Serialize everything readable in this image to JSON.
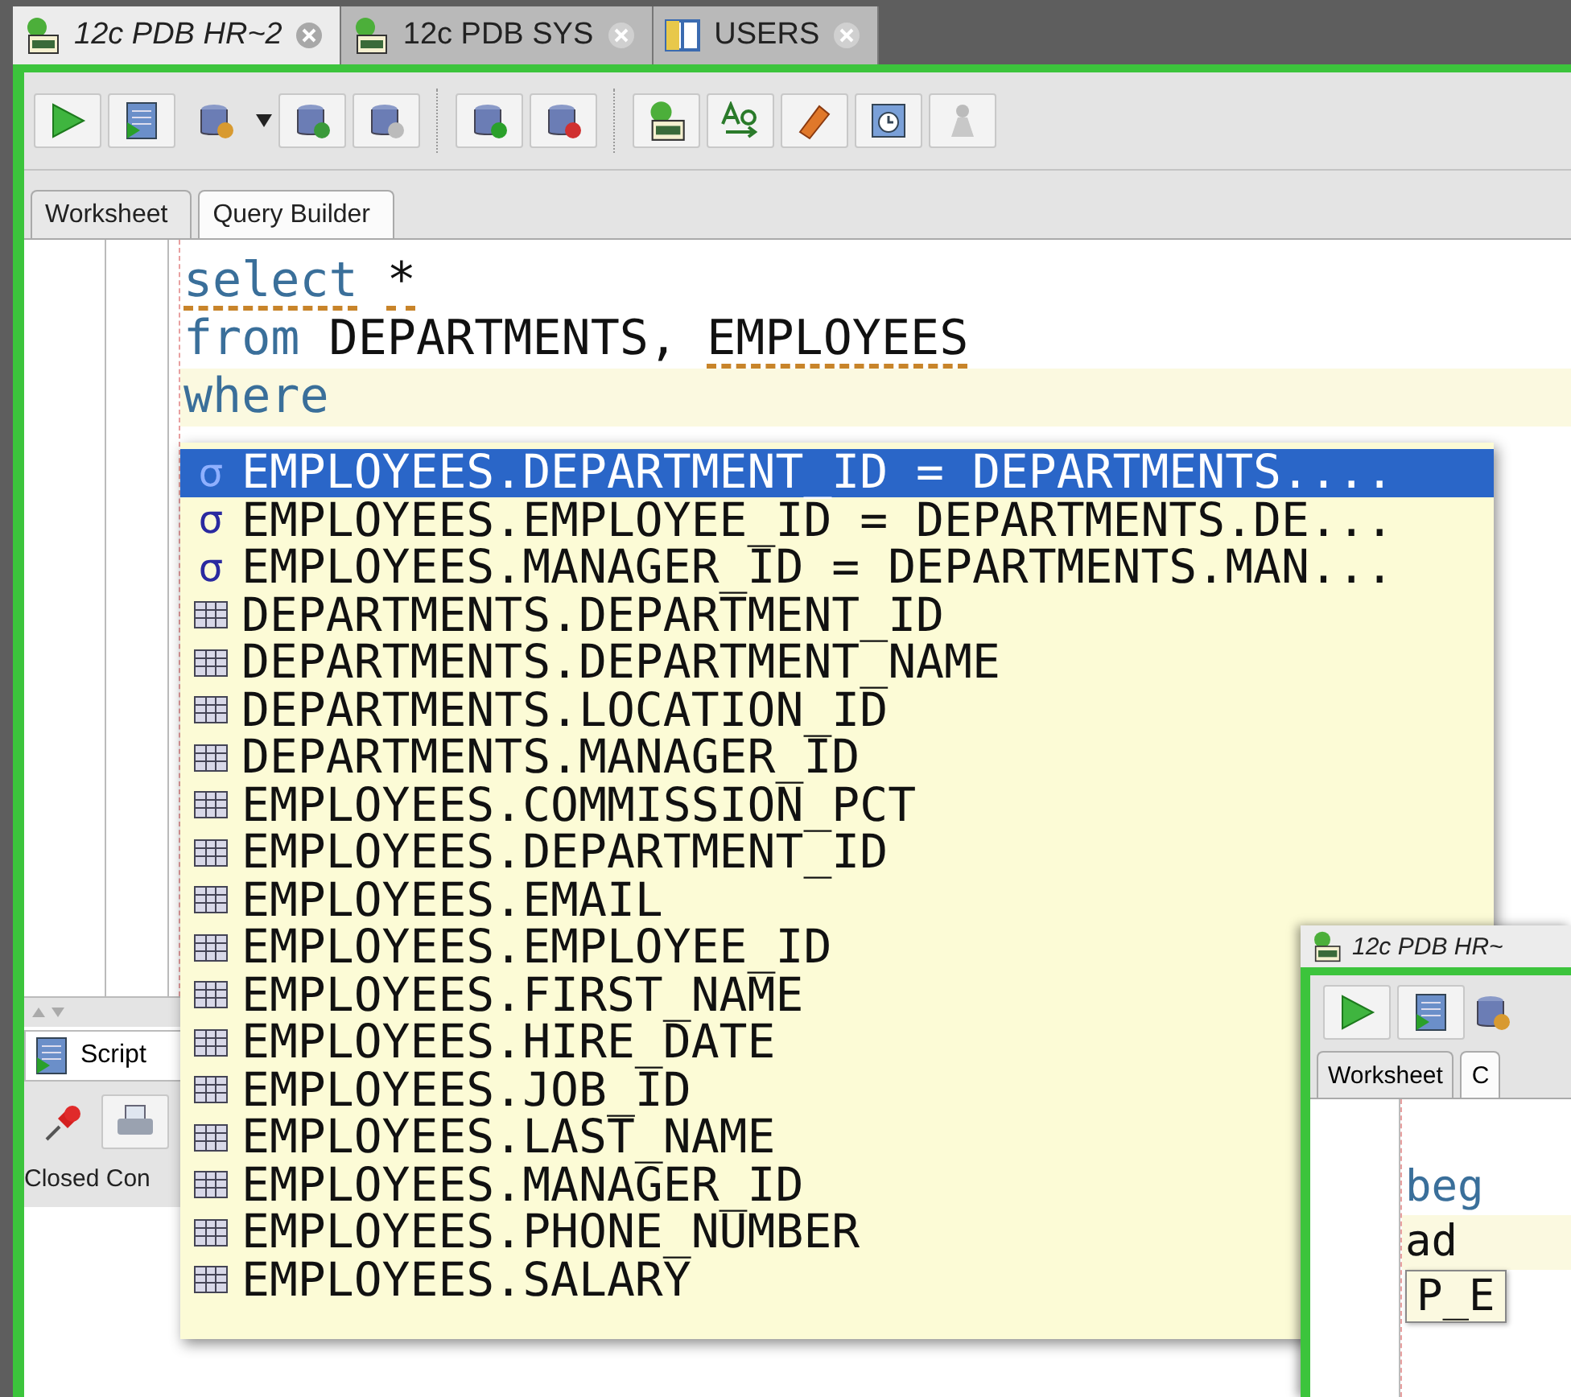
{
  "document_tabs": [
    {
      "label": "12c PDB HR~2",
      "kind": "sql",
      "modified": true,
      "selected": true
    },
    {
      "label": "12c PDB SYS",
      "kind": "sql",
      "modified": false,
      "selected": false
    },
    {
      "label": "USERS",
      "kind": "table",
      "modified": false,
      "selected": false
    }
  ],
  "editor_tabs": [
    {
      "label": "Worksheet",
      "selected": true
    },
    {
      "label": "Query Builder",
      "selected": false
    }
  ],
  "code_lines": [
    {
      "current": false,
      "tokens": [
        {
          "text": "select",
          "kind": "keyword",
          "flagged": true
        },
        {
          "text": "*",
          "kind": "plain",
          "flagged": true
        }
      ]
    },
    {
      "current": false,
      "tokens": [
        {
          "text": "from",
          "kind": "keyword",
          "flagged": false
        },
        {
          "text": "DEPARTMENTS,",
          "kind": "plain",
          "flagged": false
        },
        {
          "text": "EMPLOYEES",
          "kind": "plain",
          "flagged": true
        }
      ]
    },
    {
      "current": true,
      "tokens": [
        {
          "text": "where",
          "kind": "keyword",
          "flagged": false
        }
      ]
    }
  ],
  "completion_popup": {
    "items": [
      {
        "kind": "join",
        "symbol": "σ",
        "text": "EMPLOYEES.DEPARTMENT_ID = DEPARTMENTS....",
        "selected": true
      },
      {
        "kind": "join",
        "symbol": "σ",
        "text": "EMPLOYEES.EMPLOYEE_ID = DEPARTMENTS.DE...",
        "selected": false
      },
      {
        "kind": "join",
        "symbol": "σ",
        "text": "EMPLOYEES.MANAGER_ID = DEPARTMENTS.MAN...",
        "selected": false
      },
      {
        "kind": "column",
        "text": "DEPARTMENTS.DEPARTMENT_ID",
        "selected": false
      },
      {
        "kind": "column",
        "text": "DEPARTMENTS.DEPARTMENT_NAME",
        "selected": false
      },
      {
        "kind": "column",
        "text": "DEPARTMENTS.LOCATION_ID",
        "selected": false
      },
      {
        "kind": "column",
        "text": "DEPARTMENTS.MANAGER_ID",
        "selected": false
      },
      {
        "kind": "column",
        "text": "EMPLOYEES.COMMISSION_PCT",
        "selected": false
      },
      {
        "kind": "column",
        "text": "EMPLOYEES.DEPARTMENT_ID",
        "selected": false
      },
      {
        "kind": "column",
        "text": "EMPLOYEES.EMAIL",
        "selected": false
      },
      {
        "kind": "column",
        "text": "EMPLOYEES.EMPLOYEE_ID",
        "selected": false
      },
      {
        "kind": "column",
        "text": "EMPLOYEES.FIRST_NAME",
        "selected": false
      },
      {
        "kind": "column",
        "text": "EMPLOYEES.HIRE_DATE",
        "selected": false
      },
      {
        "kind": "column",
        "text": "EMPLOYEES.JOB_ID",
        "selected": false
      },
      {
        "kind": "column",
        "text": "EMPLOYEES.LAST_NAME",
        "selected": false
      },
      {
        "kind": "column",
        "text": "EMPLOYEES.MANAGER_ID",
        "selected": false
      },
      {
        "kind": "column",
        "text": "EMPLOYEES.PHONE_NUMBER",
        "selected": false
      },
      {
        "kind": "column",
        "text": "EMPLOYEES.SALARY",
        "selected": false
      }
    ]
  },
  "output_panel": {
    "tab": "Script",
    "status": "Closed Con"
  },
  "second_window": {
    "tab": {
      "label": "12c PDB HR~",
      "modified": true
    },
    "editor_tabs": [
      {
        "label": "Worksheet",
        "selected": true
      },
      {
        "label": "C",
        "selected": false
      }
    ],
    "code_lines": [
      {
        "text": "beg",
        "kind": "keyword",
        "current": false,
        "boxed": false
      },
      {
        "text": "ad",
        "kind": "plain",
        "current": true,
        "boxed": false
      },
      {
        "text": "P_E",
        "kind": "plain",
        "current": false,
        "boxed": true
      }
    ]
  }
}
